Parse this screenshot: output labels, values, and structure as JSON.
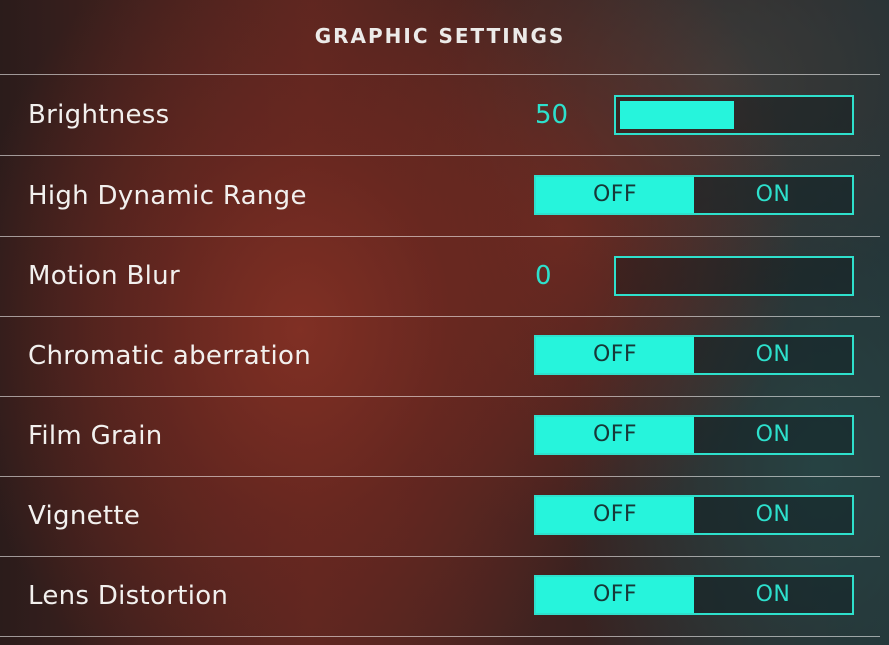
{
  "header": {
    "title": "GRAPHIC SETTINGS"
  },
  "settings": [
    {
      "label": "Brightness",
      "type": "slider",
      "value": "50",
      "level": 0.5
    },
    {
      "label": "High Dynamic Range",
      "type": "toggle",
      "off_label": "OFF",
      "on_label": "ON",
      "selected": "OFF"
    },
    {
      "label": "Motion Blur",
      "type": "slider",
      "value": "0",
      "level": 0
    },
    {
      "label": "Chromatic aberration",
      "type": "toggle",
      "off_label": "OFF",
      "on_label": "ON",
      "selected": "OFF"
    },
    {
      "label": "Film Grain",
      "type": "toggle",
      "off_label": "OFF",
      "on_label": "ON",
      "selected": "OFF"
    },
    {
      "label": "Vignette",
      "type": "toggle",
      "off_label": "OFF",
      "on_label": "ON",
      "selected": "OFF"
    },
    {
      "label": "Lens Distortion",
      "type": "toggle",
      "off_label": "OFF",
      "on_label": "ON",
      "selected": "OFF"
    }
  ],
  "colors": {
    "accent": "#26f4dc",
    "accent_text": "#2de0cc",
    "selected_text": "#173838"
  }
}
